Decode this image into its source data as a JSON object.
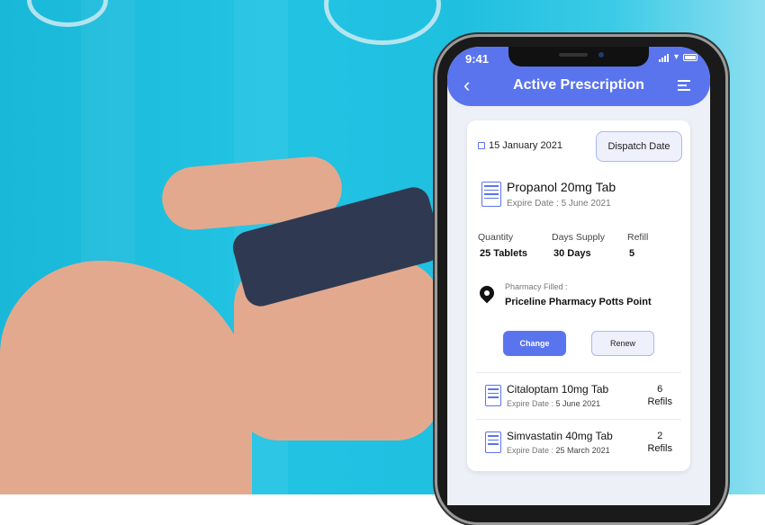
{
  "status_bar": {
    "time": "9:41"
  },
  "app_bar": {
    "title": "Active Prescription",
    "back_icon": "chevron-left-icon",
    "menu_icon": "menu-icon"
  },
  "prescription": {
    "date": "15 January 2021",
    "dispatch_button": "Dispatch Date",
    "drug_name": "Propanol 20mg Tab",
    "expire": "Expire Date : 5 June 2021",
    "stats": [
      {
        "label": "Quantity",
        "value": "25 Tablets"
      },
      {
        "label": "Days Supply",
        "value": "30 Days"
      },
      {
        "label": "Refill",
        "value": "5"
      }
    ],
    "pharmacy_label": "Pharmacy Filled :",
    "pharmacy_name": "Priceline Pharmacy Potts Point",
    "change_button": "Change",
    "renew_button": "Renew"
  },
  "other_prescriptions": [
    {
      "name": "Citaloptam 10mg Tab",
      "expire_label": "Expire Date :",
      "expire_date": "5 June 2021",
      "refill_count": "6",
      "refill_label": "Refils"
    },
    {
      "name": "Simvastatin 40mg Tab",
      "expire_label": "Expire Date :",
      "expire_date": "25 March 2021",
      "refill_count": "2",
      "refill_label": "Refils"
    }
  ],
  "colors": {
    "primary": "#5a74ee",
    "background": "#22c3e3",
    "screen_bg": "#eef0f7"
  }
}
